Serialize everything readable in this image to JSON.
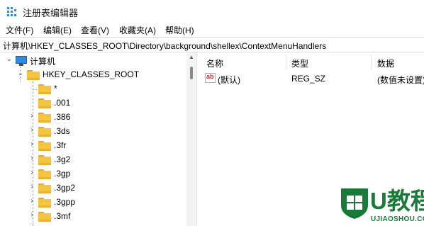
{
  "window": {
    "title": "注册表编辑器"
  },
  "menu": [
    "文件(F)",
    "编辑(E)",
    "查看(V)",
    "收藏夹(A)",
    "帮助(H)"
  ],
  "address": "计算机\\HKEY_CLASSES_ROOT\\Directory\\background\\shellex\\ContextMenuHandlers",
  "tree": {
    "root": "计算机",
    "hive": "HKEY_CLASSES_ROOT",
    "children": [
      "*",
      ".001",
      ".386",
      ".3ds",
      ".3fr",
      ".3g2",
      ".3gp",
      ".3gp2",
      ".3gpp",
      ".3mf"
    ]
  },
  "columns": {
    "name": "名称",
    "type": "类型",
    "data": "数据"
  },
  "values": [
    {
      "name": "(默认)",
      "type": "REG_SZ",
      "data": "(数值未设置)",
      "icon": "string-value-icon"
    }
  ],
  "watermark": {
    "title": "U教程",
    "subtitle": "UJIAOSHOU.COM"
  },
  "colors": {
    "accent": "#2b8be0",
    "folder": "#f5c542",
    "watermark": "#1a7a3a"
  }
}
